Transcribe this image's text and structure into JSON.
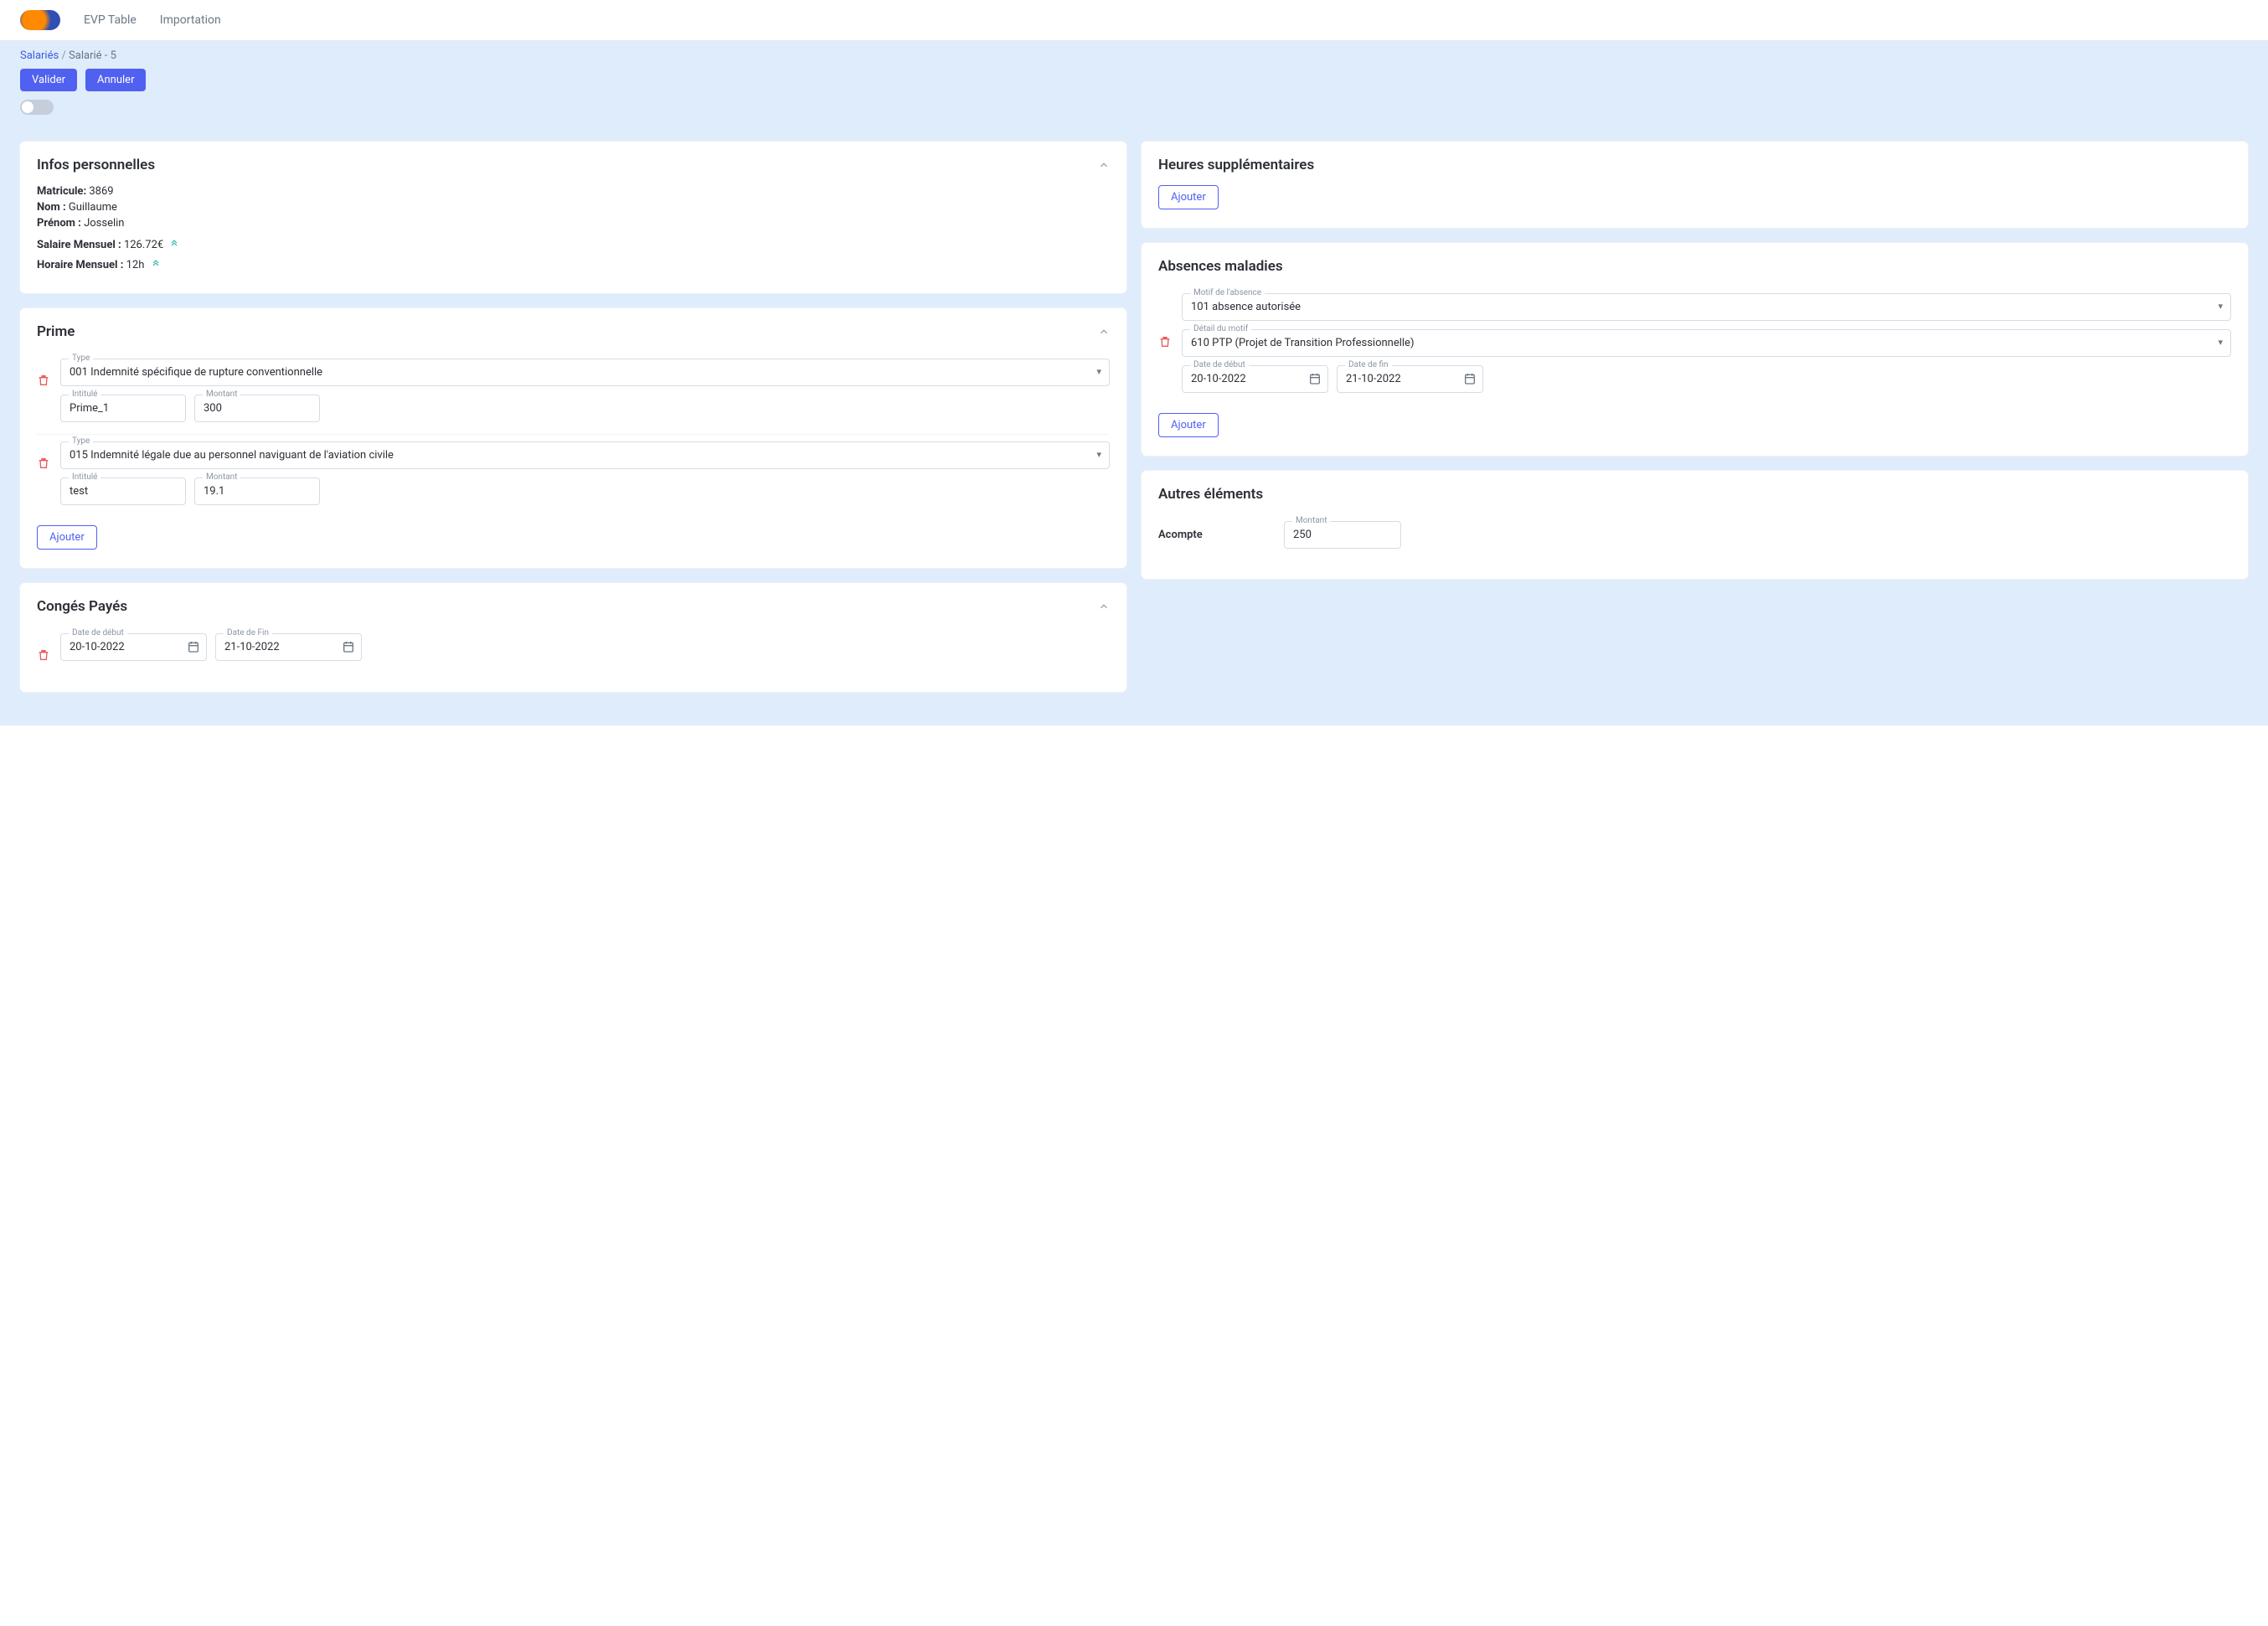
{
  "nav": {
    "evp": "EVP Table",
    "importation": "Importation"
  },
  "breadcrumb": {
    "root": "Salariés",
    "sep": "/",
    "current": "Salarié - 5"
  },
  "actions": {
    "valider": "Valider",
    "annuler": "Annuler"
  },
  "infos": {
    "title": "Infos personnelles",
    "matricule_label": "Matricule:",
    "matricule": "3869",
    "nom_label": "Nom :",
    "nom": "Guillaume",
    "prenom_label": "Prénom :",
    "prenom": "Josselin",
    "salaire_label": "Salaire Mensuel :",
    "salaire": "126.72€",
    "horaire_label": "Horaire Mensuel :",
    "horaire": "12h"
  },
  "prime": {
    "title": "Prime",
    "type_label": "Type",
    "intitule_label": "Intitulé",
    "montant_label": "Montant",
    "ajouter": "Ajouter",
    "items": [
      {
        "type": "001 Indemnité spécifique de rupture conventionnelle",
        "intitule": "Prime_1",
        "montant": "300"
      },
      {
        "type": "015 Indemnité légale due au personnel naviguant de l'aviation civile",
        "intitule": "test",
        "montant": "19.1"
      }
    ]
  },
  "conges": {
    "title": "Congés Payés",
    "debut_label": "Date de début",
    "fin_label": "Date de Fin",
    "items": [
      {
        "debut": "20-10-2022",
        "fin": "21-10-2022"
      }
    ]
  },
  "heures": {
    "title": "Heures supplémentaires",
    "ajouter": "Ajouter"
  },
  "absences": {
    "title": "Absences maladies",
    "motif_label": "Motif de l'absence",
    "detail_label": "Détail du motif",
    "debut_label": "Date de début",
    "fin_label": "Date de fin",
    "ajouter": "Ajouter",
    "items": [
      {
        "motif": "101 absence autorisée",
        "detail": "610 PTP (Projet de Transition Professionnelle)",
        "debut": "20-10-2022",
        "fin": "21-10-2022"
      }
    ]
  },
  "autres": {
    "title": "Autres éléments",
    "acompte_label": "Acompte",
    "montant_label": "Montant",
    "montant": "250"
  }
}
